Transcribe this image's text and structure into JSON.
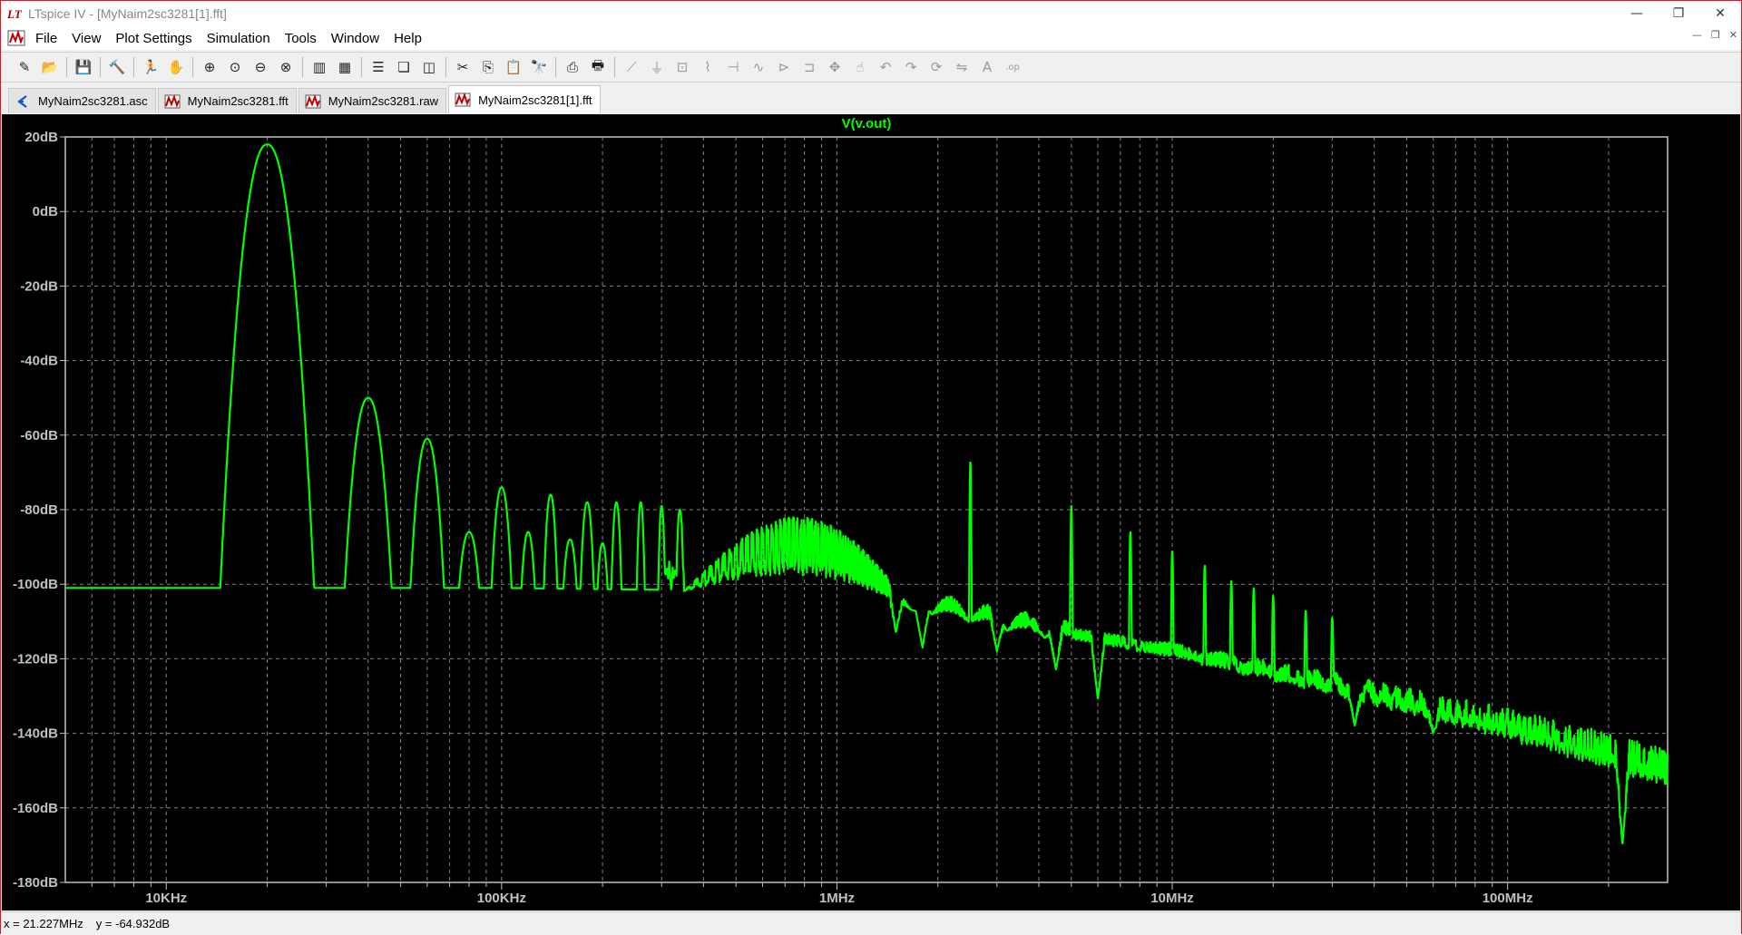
{
  "window": {
    "title": "LTspice IV - [MyNaim2sc3281[1].fft]",
    "controls": {
      "minimize": "—",
      "restore": "❐",
      "close": "✕"
    }
  },
  "menu": {
    "items": [
      "File",
      "View",
      "Plot Settings",
      "Simulation",
      "Tools",
      "Window",
      "Help"
    ],
    "mdi_controls": {
      "minimize": "—",
      "restore": "❐",
      "close": "✕"
    }
  },
  "tabs": [
    {
      "label": "MyNaim2sc3281.asc",
      "icon": "schematic-icon",
      "active": false
    },
    {
      "label": "MyNaim2sc3281.fft",
      "icon": "waveform-icon",
      "active": false
    },
    {
      "label": "MyNaim2sc3281.raw",
      "icon": "waveform-icon",
      "active": false
    },
    {
      "label": "MyNaim2sc3281[1].fft",
      "icon": "waveform-icon",
      "active": true
    }
  ],
  "toolbar": {
    "groups": [
      [
        "new-schematic-icon",
        "open-icon"
      ],
      [
        "save-icon"
      ],
      [
        "control-panel-icon"
      ],
      [
        "run-icon",
        "halt-icon"
      ],
      [
        "zoom-in-icon",
        "zoom-extent-icon",
        "zoom-out-icon",
        "zoom-cancel-icon"
      ],
      [
        "autorange-icon",
        "grid-icon"
      ],
      [
        "tile-horizontal-icon",
        "cascade-icon",
        "tile-vertical-icon"
      ],
      [
        "cut-icon",
        "copy-icon",
        "paste-icon",
        "find-icon"
      ],
      [
        "print-icon",
        "print-preview-icon"
      ],
      [
        "wire-icon",
        "ground-icon",
        "label-net-icon",
        "resistor-icon",
        "capacitor-icon",
        "inductor-icon",
        "diode-icon",
        "component-icon",
        "move-icon",
        "drag-icon",
        "undo-icon",
        "redo-icon",
        "rotate-icon",
        "mirror-icon",
        "text-icon",
        "spice-directive-icon"
      ]
    ]
  },
  "plot": {
    "trace_label": "V(v.out)",
    "trace_color": "#00ff00",
    "background": "#000000",
    "grid_color": "#808080"
  },
  "chart_data": {
    "type": "line",
    "title": "V(v.out)",
    "xlabel": "",
    "ylabel": "",
    "x_scale": "log",
    "xlim": [
      5000,
      300000000
    ],
    "ylim": [
      -180,
      20
    ],
    "y_ticks": [
      "20dB",
      "0dB",
      "-20dB",
      "-40dB",
      "-60dB",
      "-80dB",
      "-100dB",
      "-120dB",
      "-140dB",
      "-160dB",
      "-180dB"
    ],
    "y_tick_values": [
      20,
      0,
      -20,
      -40,
      -60,
      -80,
      -100,
      -120,
      -140,
      -160,
      -180
    ],
    "x_ticks": [
      "10KHz",
      "100KHz",
      "1MHz",
      "10MHz",
      "100MHz"
    ],
    "x_tick_values": [
      10000,
      100000,
      1000000,
      10000000,
      100000000
    ],
    "grid": true,
    "series": [
      {
        "name": "V(v.out)",
        "noise_floor": [
          [
            5000,
            -101
          ],
          [
            20000,
            -101
          ],
          [
            100000,
            -101
          ],
          [
            300000,
            -101.5
          ],
          [
            1000000,
            -104
          ],
          [
            1500000,
            -106
          ],
          [
            3000000,
            -112
          ],
          [
            10000000,
            -121
          ],
          [
            30000000,
            -131
          ],
          [
            100000000,
            -143
          ],
          [
            200000000,
            -151
          ],
          [
            300000000,
            -156
          ]
        ],
        "peaks": [
          {
            "f": 20000,
            "db": 18,
            "bw": 0.14
          },
          {
            "f": 40000,
            "db": -50,
            "bw": 0.07
          },
          {
            "f": 60000,
            "db": -61,
            "bw": 0.05
          },
          {
            "f": 80000,
            "db": -86,
            "bw": 0.03
          },
          {
            "f": 100000,
            "db": -74,
            "bw": 0.03
          },
          {
            "f": 120000,
            "db": -86,
            "bw": 0.02
          },
          {
            "f": 140000,
            "db": -76,
            "bw": 0.02
          },
          {
            "f": 160000,
            "db": -88,
            "bw": 0.02
          },
          {
            "f": 180000,
            "db": -78,
            "bw": 0.02
          },
          {
            "f": 200000,
            "db": -89,
            "bw": 0.015
          },
          {
            "f": 220000,
            "db": -78,
            "bw": 0.015
          },
          {
            "f": 260000,
            "db": -78,
            "bw": 0.012
          },
          {
            "f": 300000,
            "db": -79,
            "bw": 0.01
          },
          {
            "f": 340000,
            "db": -80,
            "bw": 0.01
          },
          {
            "f": 2500000,
            "db": -67,
            "bw": 0.004
          },
          {
            "f": 5000000,
            "db": -79,
            "bw": 0.004
          },
          {
            "f": 7500000,
            "db": -86,
            "bw": 0.004
          },
          {
            "f": 10000000,
            "db": -91,
            "bw": 0.004
          },
          {
            "f": 12500000,
            "db": -95,
            "bw": 0.004
          },
          {
            "f": 15000000,
            "db": -99,
            "bw": 0.004
          },
          {
            "f": 17500000,
            "db": -101,
            "bw": 0.004
          },
          {
            "f": 20000000,
            "db": -103,
            "bw": 0.004
          },
          {
            "f": 25000000,
            "db": -107,
            "bw": 0.004
          },
          {
            "f": 30000000,
            "db": -109,
            "bw": 0.004
          }
        ],
        "hump": {
          "f_start": 350000,
          "f_center": 1000000,
          "f_end": 1800000,
          "db_top": -82
        },
        "nulls": [
          {
            "f": 1500000,
            "db": -113
          },
          {
            "f": 1800000,
            "db": -117
          },
          {
            "f": 3000000,
            "db": -118
          },
          {
            "f": 4500000,
            "db": -123
          },
          {
            "f": 6000000,
            "db": -131
          },
          {
            "f": 35000000,
            "db": -138
          },
          {
            "f": 60000000,
            "db": -140
          },
          {
            "f": 220000000,
            "db": -170
          }
        ]
      }
    ]
  },
  "status": {
    "x_readout": "x = 21.227MHz",
    "y_readout": "y = -64.932dB"
  }
}
